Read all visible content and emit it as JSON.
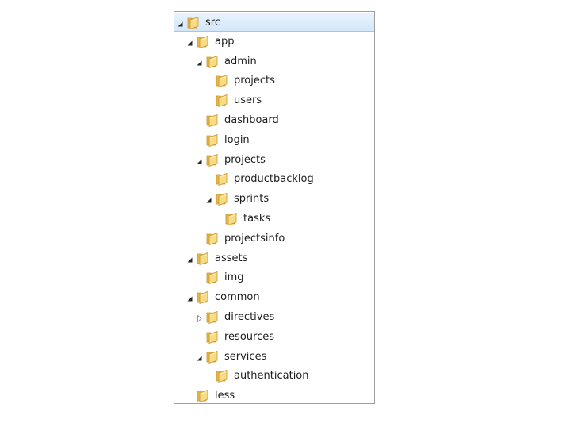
{
  "tree": [
    {
      "label": "src",
      "expander": "expanded",
      "depth": 0,
      "selected": true
    },
    {
      "label": "app",
      "expander": "expanded",
      "depth": 1
    },
    {
      "label": "admin",
      "expander": "expanded",
      "depth": 2
    },
    {
      "label": "projects",
      "expander": "none",
      "depth": 3
    },
    {
      "label": "users",
      "expander": "none",
      "depth": 3
    },
    {
      "label": "dashboard",
      "expander": "none",
      "depth": 2
    },
    {
      "label": "login",
      "expander": "none",
      "depth": 2
    },
    {
      "label": "projects",
      "expander": "expanded",
      "depth": 2
    },
    {
      "label": "productbacklog",
      "expander": "none",
      "depth": 3
    },
    {
      "label": "sprints",
      "expander": "expanded",
      "depth": 3
    },
    {
      "label": "tasks",
      "expander": "none",
      "depth": 4
    },
    {
      "label": "projectsinfo",
      "expander": "none",
      "depth": 2
    },
    {
      "label": "assets",
      "expander": "expanded",
      "depth": 1
    },
    {
      "label": "img",
      "expander": "none",
      "depth": 2
    },
    {
      "label": "common",
      "expander": "expanded",
      "depth": 1
    },
    {
      "label": "directives",
      "expander": "collapsed",
      "depth": 2
    },
    {
      "label": "resources",
      "expander": "none",
      "depth": 2
    },
    {
      "label": "services",
      "expander": "expanded",
      "depth": 2
    },
    {
      "label": "authentication",
      "expander": "none",
      "depth": 3
    },
    {
      "label": "less",
      "expander": "none",
      "depth": 1
    }
  ],
  "colors": {
    "selection_top": "#e9f3fd",
    "selection_bottom": "#d3e7fb",
    "selection_border": "#99c9f4",
    "folder_back": "#e6b84a",
    "folder_front": "#f7dc85",
    "folder_edge": "#c9962f",
    "expander": "#262626"
  },
  "icons": {
    "expanded": "expanded-triangle-icon",
    "collapsed": "collapsed-triangle-icon",
    "folder": "folder-icon"
  }
}
